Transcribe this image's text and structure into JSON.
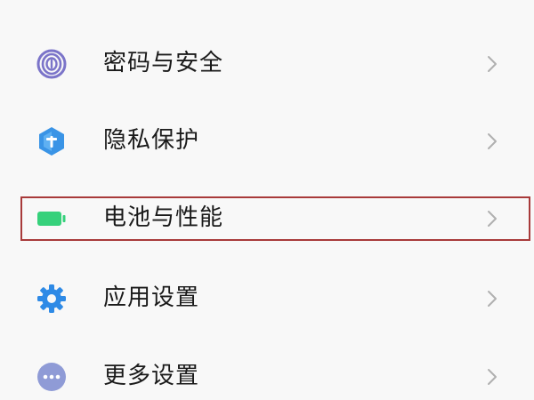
{
  "settings": {
    "items": [
      {
        "label": "密码与安全",
        "icon": "fingerprint-icon",
        "color": "#7b74c9"
      },
      {
        "label": "隐私保护",
        "icon": "privacy-shield-icon",
        "color": "#3a94e6"
      },
      {
        "label": "电池与性能",
        "icon": "battery-icon",
        "color": "#36d17b"
      },
      {
        "label": "应用设置",
        "icon": "gear-icon",
        "color": "#2e8ae6"
      },
      {
        "label": "更多设置",
        "icon": "more-dots-icon",
        "color": "#8f9bd6"
      }
    ],
    "highlighted_index": 2,
    "highlight_color": "#a83a3a"
  }
}
